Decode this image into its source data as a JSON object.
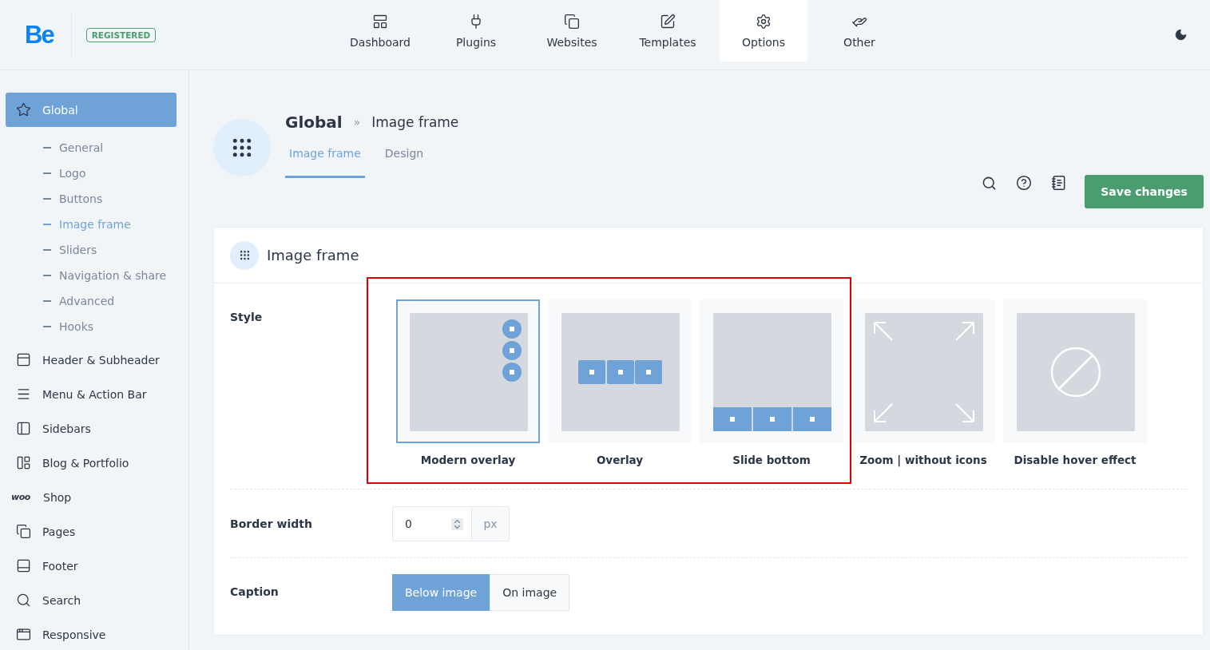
{
  "header": {
    "logo": "Be",
    "badge": "REGISTERED",
    "nav": [
      {
        "label": "Dashboard",
        "selected": false
      },
      {
        "label": "Plugins",
        "selected": false
      },
      {
        "label": "Websites",
        "selected": false
      },
      {
        "label": "Templates",
        "selected": false
      },
      {
        "label": "Options",
        "selected": true
      },
      {
        "label": "Other",
        "selected": false
      }
    ]
  },
  "sidebar": {
    "items": [
      {
        "label": "Global",
        "selected": true,
        "children": [
          {
            "label": "General",
            "selected": false
          },
          {
            "label": "Logo",
            "selected": false
          },
          {
            "label": "Buttons",
            "selected": false
          },
          {
            "label": "Image frame",
            "selected": true
          },
          {
            "label": "Sliders",
            "selected": false
          },
          {
            "label": "Navigation & share",
            "selected": false
          },
          {
            "label": "Advanced",
            "selected": false
          },
          {
            "label": "Hooks",
            "selected": false
          }
        ]
      },
      {
        "label": "Header & Subheader",
        "selected": false
      },
      {
        "label": "Menu & Action Bar",
        "selected": false
      },
      {
        "label": "Sidebars",
        "selected": false
      },
      {
        "label": "Blog & Portfolio",
        "selected": false
      },
      {
        "label": "Shop",
        "selected": false,
        "icon_text": "woo"
      },
      {
        "label": "Pages",
        "selected": false
      },
      {
        "label": "Footer",
        "selected": false
      },
      {
        "label": "Search",
        "selected": false
      },
      {
        "label": "Responsive",
        "selected": false
      }
    ]
  },
  "page": {
    "breadcrumb": [
      "Global",
      "»",
      "Image frame"
    ],
    "tabs": [
      {
        "label": "Image frame",
        "selected": true
      },
      {
        "label": "Design",
        "selected": false
      }
    ],
    "save_button": "Save changes"
  },
  "card": {
    "title": "Image frame",
    "style": {
      "label": "Style",
      "options": [
        {
          "kind": "modern_overlay",
          "label": "Modern overlay",
          "selected": true,
          "highlighted": true
        },
        {
          "kind": "overlay",
          "label": "Overlay",
          "selected": false,
          "highlighted": true
        },
        {
          "kind": "slide_bottom",
          "label": "Slide bottom",
          "selected": false,
          "highlighted": true
        },
        {
          "kind": "zoom",
          "label": "Zoom | without icons",
          "selected": false,
          "highlighted": false
        },
        {
          "kind": "none",
          "label": "Disable hover effect",
          "selected": false,
          "highlighted": false
        }
      ]
    },
    "border_width": {
      "label": "Border width",
      "value": "0",
      "unit": "px"
    },
    "caption": {
      "label": "Caption",
      "options": [
        {
          "label": "Below image",
          "selected": true
        },
        {
          "label": "On image",
          "selected": false
        }
      ]
    }
  }
}
